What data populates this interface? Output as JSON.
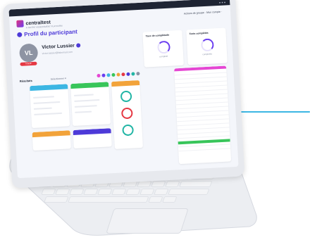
{
  "brand": {
    "name": "centraltest",
    "tagline": "A TALENT ASSESSMENT PLATFORM"
  },
  "nav": {
    "links_text": "Actions de groupe  ·  Mon compte  ·"
  },
  "page": {
    "title": "Profil du participant"
  },
  "participant": {
    "initials": "VL",
    "name": "Victor Lussier",
    "email": "victor.lussier@fakemail.com",
    "badge": "Inactif"
  },
  "stats": [
    {
      "label": "Taux de complétude",
      "sub": "complété"
    },
    {
      "label": "Tests complétés",
      "sub": "complétés"
    }
  ],
  "results": {
    "label": "Résultats",
    "selector": "Sélectionner ▾",
    "tag": "Filtrer"
  },
  "colors": {
    "accent": "#3cb6e3",
    "brand": "#4d3ad8",
    "pink": "#e2327d",
    "green": "#38c55a",
    "orange": "#f2a33a",
    "purple": "#6a3df0",
    "teal": "#21b5a5"
  },
  "palette": [
    "#e546d3",
    "#6a3df0",
    "#3cb6e3",
    "#38c55a",
    "#f2a33a",
    "#e53843",
    "#4d3ad8",
    "#21b5a5",
    "#8a93a6"
  ]
}
